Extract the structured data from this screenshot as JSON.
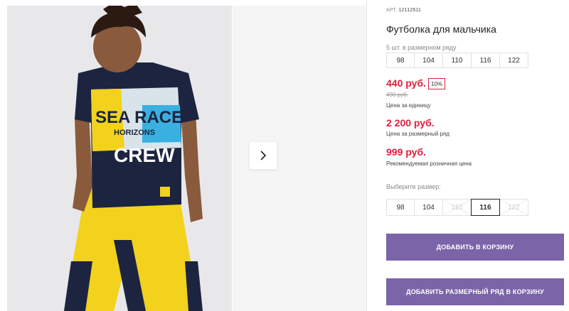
{
  "product": {
    "sku_prefix": "АРТ.",
    "sku": "12112511",
    "title": "Футболка для мальчика",
    "pack_note": "5 шт. в размерном ряду",
    "pack_sizes": [
      "98",
      "104",
      "110",
      "116",
      "122"
    ],
    "price": "440 руб.",
    "discount": "10%",
    "old_price": "490 руб.",
    "price_label": "Цена за единицу",
    "pack_price": "2 200 руб.",
    "pack_price_label": "Цена за размерный ряд",
    "retail_price": "999 руб.",
    "retail_price_label": "Рекомендуемая розничная цена",
    "select_size_label": "Выберите размер:",
    "select_sizes": [
      {
        "label": "98",
        "state": "available"
      },
      {
        "label": "104",
        "state": "available"
      },
      {
        "label": "110",
        "state": "disabled"
      },
      {
        "label": "116",
        "state": "selected"
      },
      {
        "label": "122",
        "state": "disabled"
      }
    ],
    "add_to_cart": "ДОБАВИТЬ В КОРЗИНУ",
    "add_pack_to_cart": "ДОБАВИТЬ РАЗМЕРНЫЙ РЯД В КОРЗИНУ"
  },
  "gallery": {
    "shirt_text": [
      "SEA RACE",
      "HORIZONS",
      "CREW"
    ],
    "next_icon": "chevron-right-icon"
  },
  "colors": {
    "accent_red": "#e01e3c",
    "button_purple": "#7b64a8",
    "shirt_navy": "#1c2440",
    "pants_yellow": "#f2d21c"
  }
}
